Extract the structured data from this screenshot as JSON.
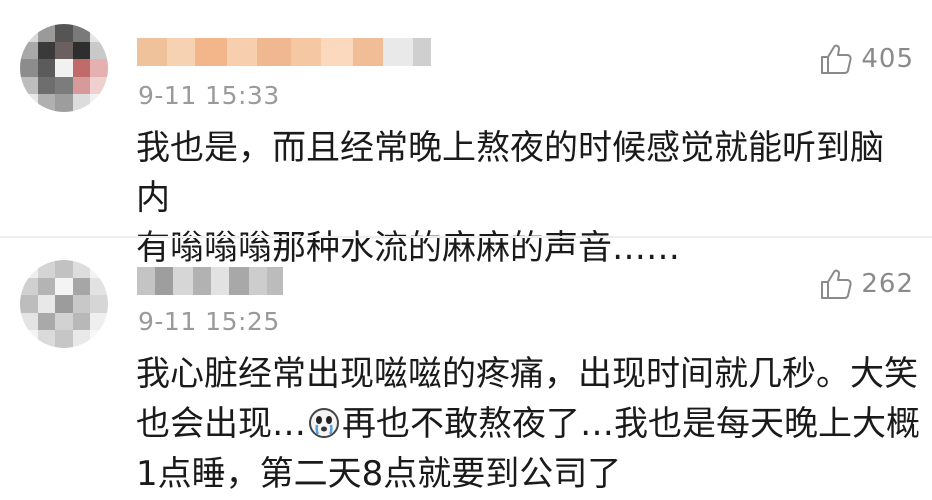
{
  "comments": [
    {
      "timestamp": "9-11 15:33",
      "likes": "405",
      "line1": "我也是，而且经常晚上熬夜的时候感觉就能听到脑内",
      "line2": "有嗡嗡嗡那种水流的麻麻的声音……",
      "username_blurred": true,
      "avatar_blurred": true
    },
    {
      "timestamp": "9-11 15:25",
      "likes": "262",
      "line1": "我心脏经常出现嗞嗞的疼痛，出现时间就几秒。大笑",
      "line2a": "也会出现…",
      "line2b": "再也不敢熬夜了…我也是每天晚上大概",
      "line3": "1点睡，第二天8点就要到公司了",
      "inline_emoji": "crying-face-icon",
      "username_blurred": true,
      "avatar_blurred": true
    }
  ],
  "colors": {
    "timestamp": "#9a9a9a",
    "text": "#1a1a1a",
    "like": "#888888",
    "divider": "#eeeeee",
    "username_blur_1": "#f3b58a",
    "username_blur_2": "#b9b9b9"
  }
}
